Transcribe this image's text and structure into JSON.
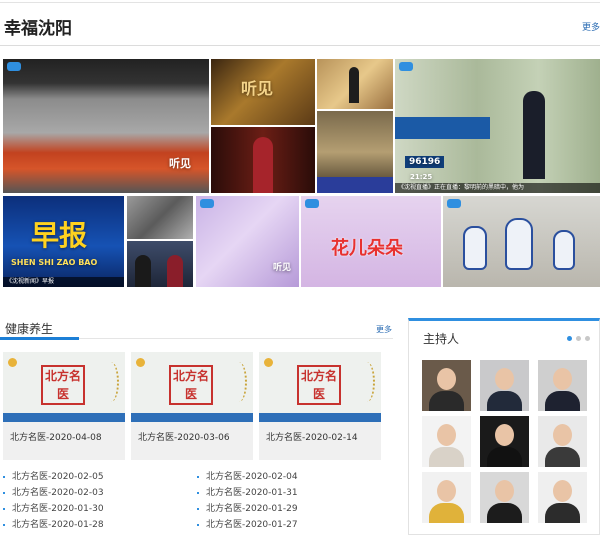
{
  "section": {
    "title": "幸福沈阳",
    "more": "更多"
  },
  "gallery": {
    "captions": [
      "《沈视新闻》早报",
      "《沈视直播》正在直播：黎明前的黑暗中，他为"
    ],
    "marks": [
      "听见",
      "早报",
      "SHEN SHI ZAO BAO",
      "花儿朵朵",
      "96196",
      "21:25"
    ]
  },
  "health": {
    "title": "健康养生",
    "more": "更多",
    "cards": [
      "北方名医-2020-04-08",
      "北方名医-2020-03-06",
      "北方名医-2020-02-14"
    ],
    "seal_text": "北方名医",
    "list_left": [
      "北方名医-2020-02-05",
      "北方名医-2020-02-03",
      "北方名医-2020-01-30",
      "北方名医-2020-01-28"
    ],
    "list_right": [
      "北方名医-2020-02-04",
      "北方名医-2020-01-31",
      "北方名医-2020-01-29",
      "北方名医-2020-01-27"
    ]
  },
  "hosts": {
    "title": "主持人",
    "count": 9,
    "carousel_pages": 3,
    "active_page": 1
  },
  "colors": {
    "accent": "#2f8fe0",
    "title_underline": "#1d7fd6",
    "seal": "#c7322e"
  }
}
